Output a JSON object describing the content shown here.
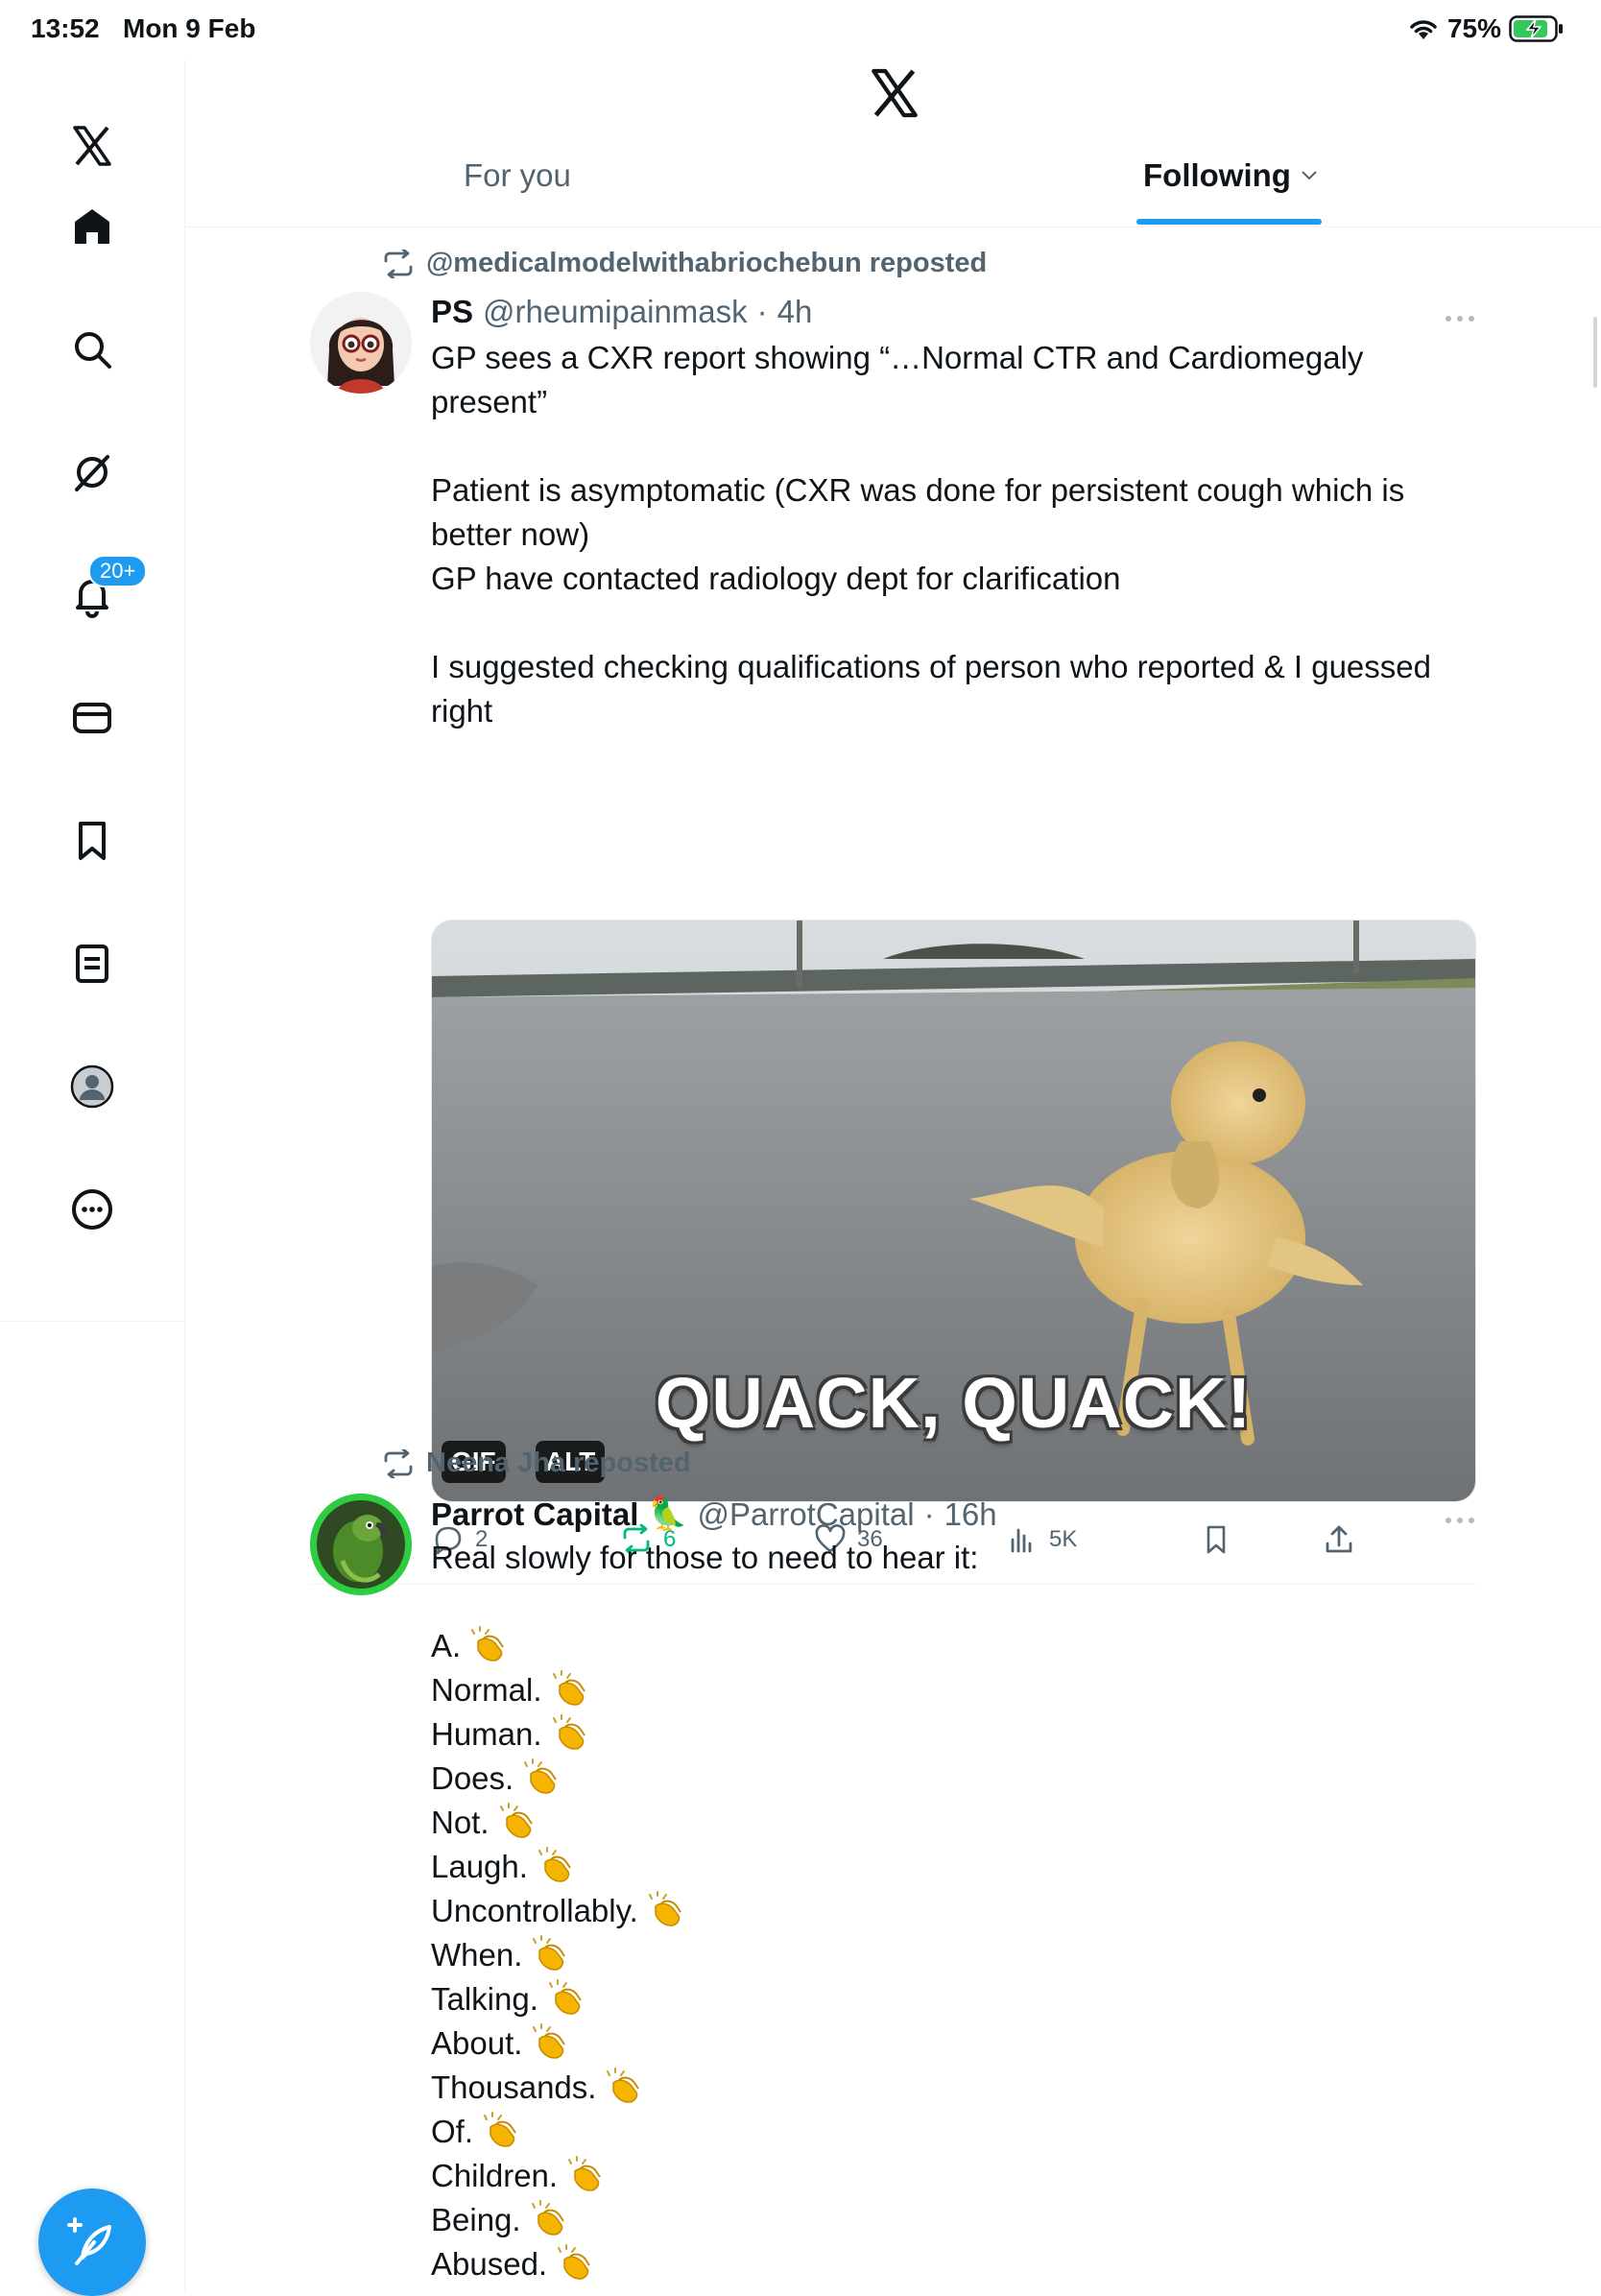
{
  "status_bar": {
    "time": "13:52",
    "date": "Mon 9 Feb",
    "battery": "75%"
  },
  "sidebar": {
    "notifications_badge": "20+",
    "items": [
      "home",
      "search",
      "grok",
      "notifications",
      "messages",
      "bookmarks",
      "lists",
      "profile",
      "more"
    ],
    "compose_label": "Post"
  },
  "header": {
    "tabs": [
      {
        "label": "For you"
      },
      {
        "label": "Following"
      }
    ],
    "active_tab": "Following"
  },
  "feed": {
    "tweets": [
      {
        "repost_label": "@medicalmodelwithabriochebun reposted",
        "author_name": "PS",
        "author_handle": "@rheumipainmask",
        "time": "4h",
        "paragraphs": [
          "GP sees a CXR report showing “…Normal CTR and Cardiomegaly present”",
          "Patient is asymptomatic (CXR was done for persistent cough which is better now)\nGP have contacted radiology dept for clarification",
          "I suggested checking qualifications of person who reported & I guessed right"
        ],
        "media": {
          "type": "gif",
          "caption": "QUACK, QUACK!",
          "gif_badge": "GIF",
          "alt_badge": "ALT"
        },
        "stats": {
          "replies": "2",
          "reposts": "6",
          "likes": "36",
          "views": "5K"
        }
      },
      {
        "repost_label": "Neena Jha reposted",
        "author_name": "Parrot Capital",
        "author_emoji": "🦜",
        "author_handle": "@ParrotCapital",
        "time": "16h",
        "first_line": "Real slowly for those to need to hear it:",
        "lines": [
          "A.",
          "Normal.",
          "Human.",
          "Does.",
          "Not.",
          "Laugh.",
          "Uncontrollably.",
          "When.",
          "Talking.",
          "About.",
          "Thousands.",
          "Of.",
          "Children.",
          "Being.",
          "Abused."
        ]
      }
    ]
  },
  "colors": {
    "accent": "#1d9bf0",
    "repost_green": "#00ba7c",
    "secondary_text": "#536471"
  }
}
